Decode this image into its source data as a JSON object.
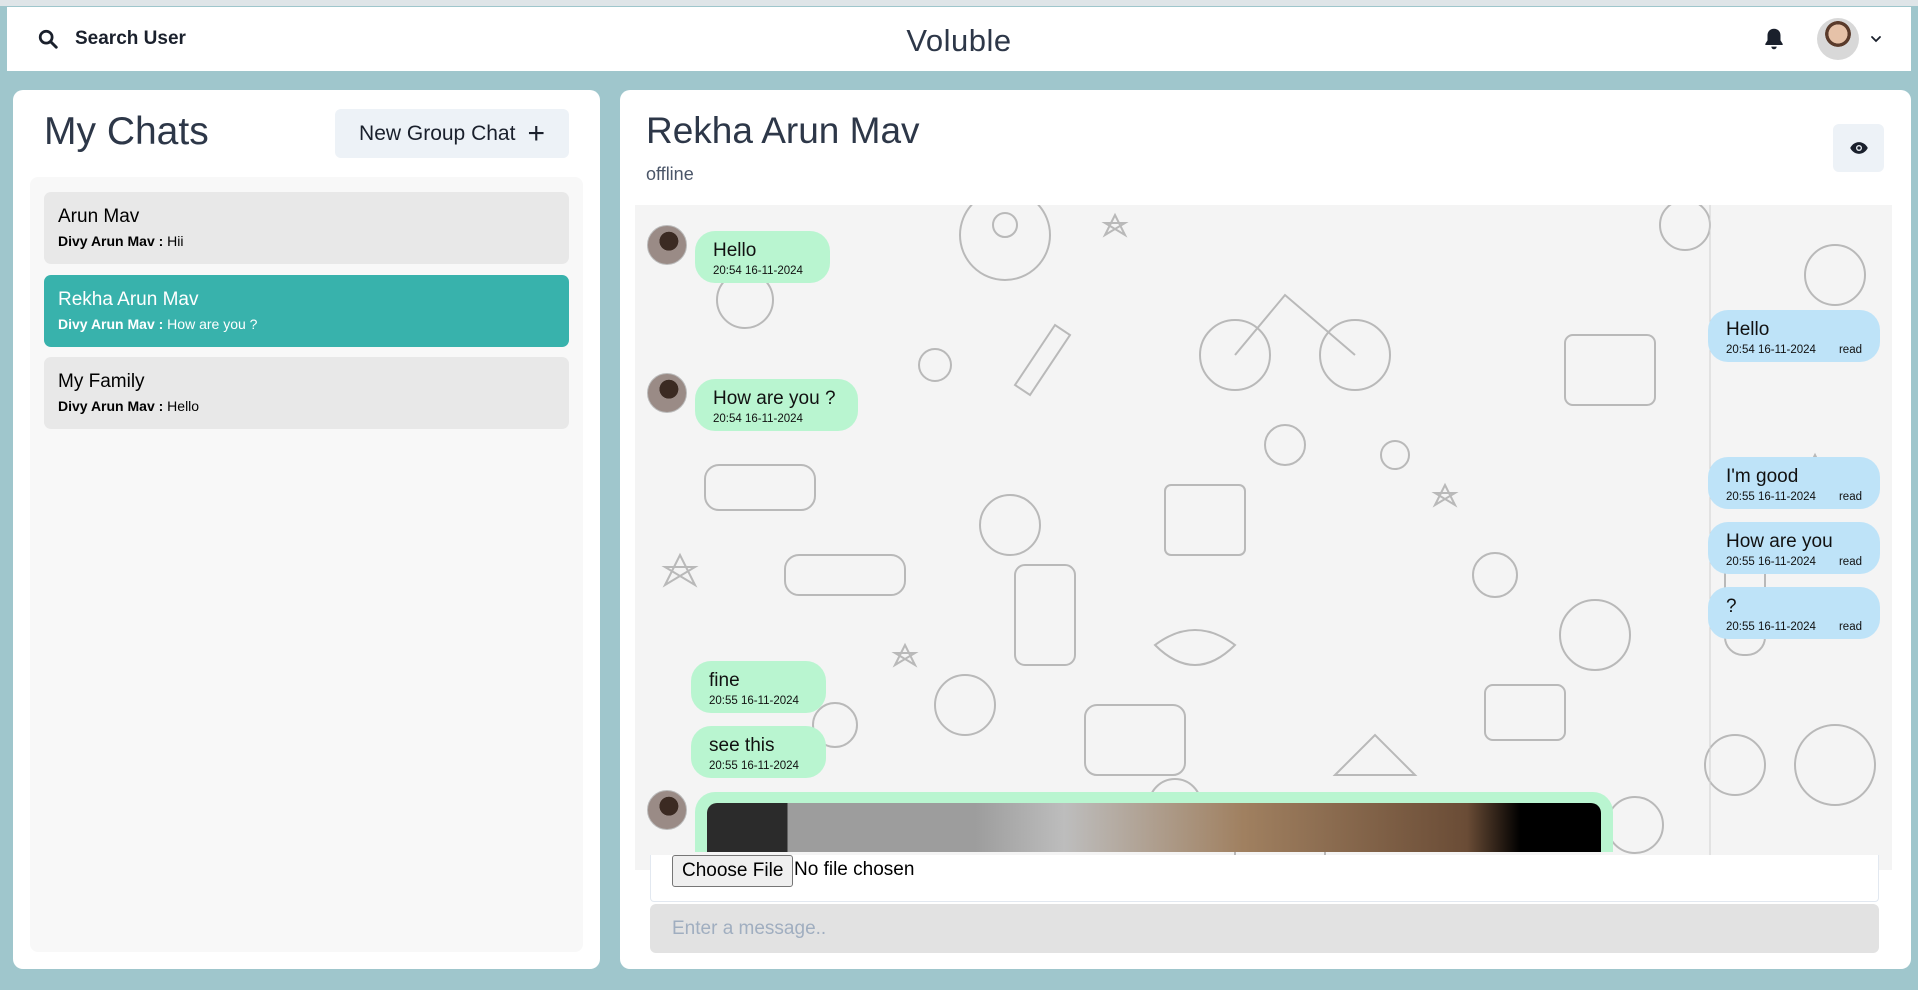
{
  "header": {
    "search_label": "Search User",
    "app_title": "Voluble"
  },
  "sidebar": {
    "title": "My Chats",
    "new_group_label": "New Group Chat",
    "chats": [
      {
        "name": "Arun Mav",
        "sender": "Divy Arun Mav :",
        "preview": "Hii",
        "active": false
      },
      {
        "name": "Rekha Arun Mav",
        "sender": "Divy Arun Mav :",
        "preview": "How are you ?",
        "active": true
      },
      {
        "name": "My Family",
        "sender": "Divy Arun Mav :",
        "preview": "Hello",
        "active": false
      }
    ]
  },
  "conversation": {
    "title": "Rekha Arun Mav",
    "status": "offline",
    "messages": [
      {
        "side": "received",
        "text": "Hello",
        "time": "20:54 16-11-2024"
      },
      {
        "side": "sent",
        "text": "Hello",
        "time": "20:54 16-11-2024",
        "receipt": "read"
      },
      {
        "side": "received",
        "text": "How are you ?",
        "time": "20:54 16-11-2024"
      },
      {
        "side": "sent",
        "text": "I'm good",
        "time": "20:55 16-11-2024",
        "receipt": "read"
      },
      {
        "side": "sent",
        "text": "How are you",
        "time": "20:55 16-11-2024",
        "receipt": "read"
      },
      {
        "side": "sent",
        "text": "?",
        "time": "20:55 16-11-2024",
        "receipt": "read"
      },
      {
        "side": "received",
        "text": "fine",
        "time": "20:55 16-11-2024"
      },
      {
        "side": "received",
        "text": "see this",
        "time": "20:55 16-11-2024"
      }
    ],
    "file_button": "Choose File",
    "file_status": "No file chosen",
    "input_placeholder": "Enter a message.."
  },
  "colors": {
    "page_bg": "#9fc6cc",
    "active_chat": "#38b2ac",
    "received_bubble": "#b9f5d0",
    "sent_bubble": "#bee3f8"
  },
  "icons": {
    "search": "search-icon",
    "bell": "bell-icon",
    "chevron": "chevron-down-icon",
    "plus": "plus-icon",
    "eye": "eye-icon"
  }
}
